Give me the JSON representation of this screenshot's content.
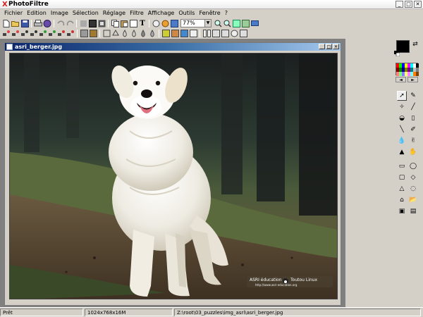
{
  "app": {
    "title": "PhotoFiltre",
    "logo_glyph": "X"
  },
  "window_controls": {
    "minimize": "_",
    "maximize": "□",
    "close": "✕"
  },
  "menu": [
    "Fichier",
    "Edition",
    "Image",
    "Sélection",
    "Réglage",
    "Filtre",
    "Affichage",
    "Outils",
    "Fenêtre",
    "?"
  ],
  "toolbar": {
    "zoom_value": "77%",
    "zoom_arrow": "▼"
  },
  "document": {
    "title": "asri_berger.jpg"
  },
  "watermark": {
    "brand": "ASRI éducation",
    "tagline": "Toutou Linux",
    "url": "http://www.asri-education.org"
  },
  "palette_arrows": {
    "left": "◄",
    "right": "►"
  },
  "status": {
    "ready": "Prêt",
    "dimensions": "1024x768x16M",
    "path": "Z:\\root\\03_puzzles\\img_asri\\asri_berger.jpg"
  },
  "colors": {
    "foreground": "#000000",
    "background": "#ffffff",
    "title_gradient_start": "#0a246a",
    "title_gradient_end": "#a6caf0",
    "palette": [
      "#ff0000",
      "#00ff00",
      "#0000ff",
      "#ffff00",
      "#ff00ff",
      "#00ffff",
      "#ffffff",
      "#000000",
      "#800000",
      "#008000",
      "#000080",
      "#808000",
      "#800080",
      "#008080",
      "#c0c0c0",
      "#808080",
      "#ff8080",
      "#80ff80",
      "#8080ff",
      "#ffff80",
      "#ff80ff",
      "#80ffff",
      "#ff8000",
      "#804000"
    ]
  }
}
